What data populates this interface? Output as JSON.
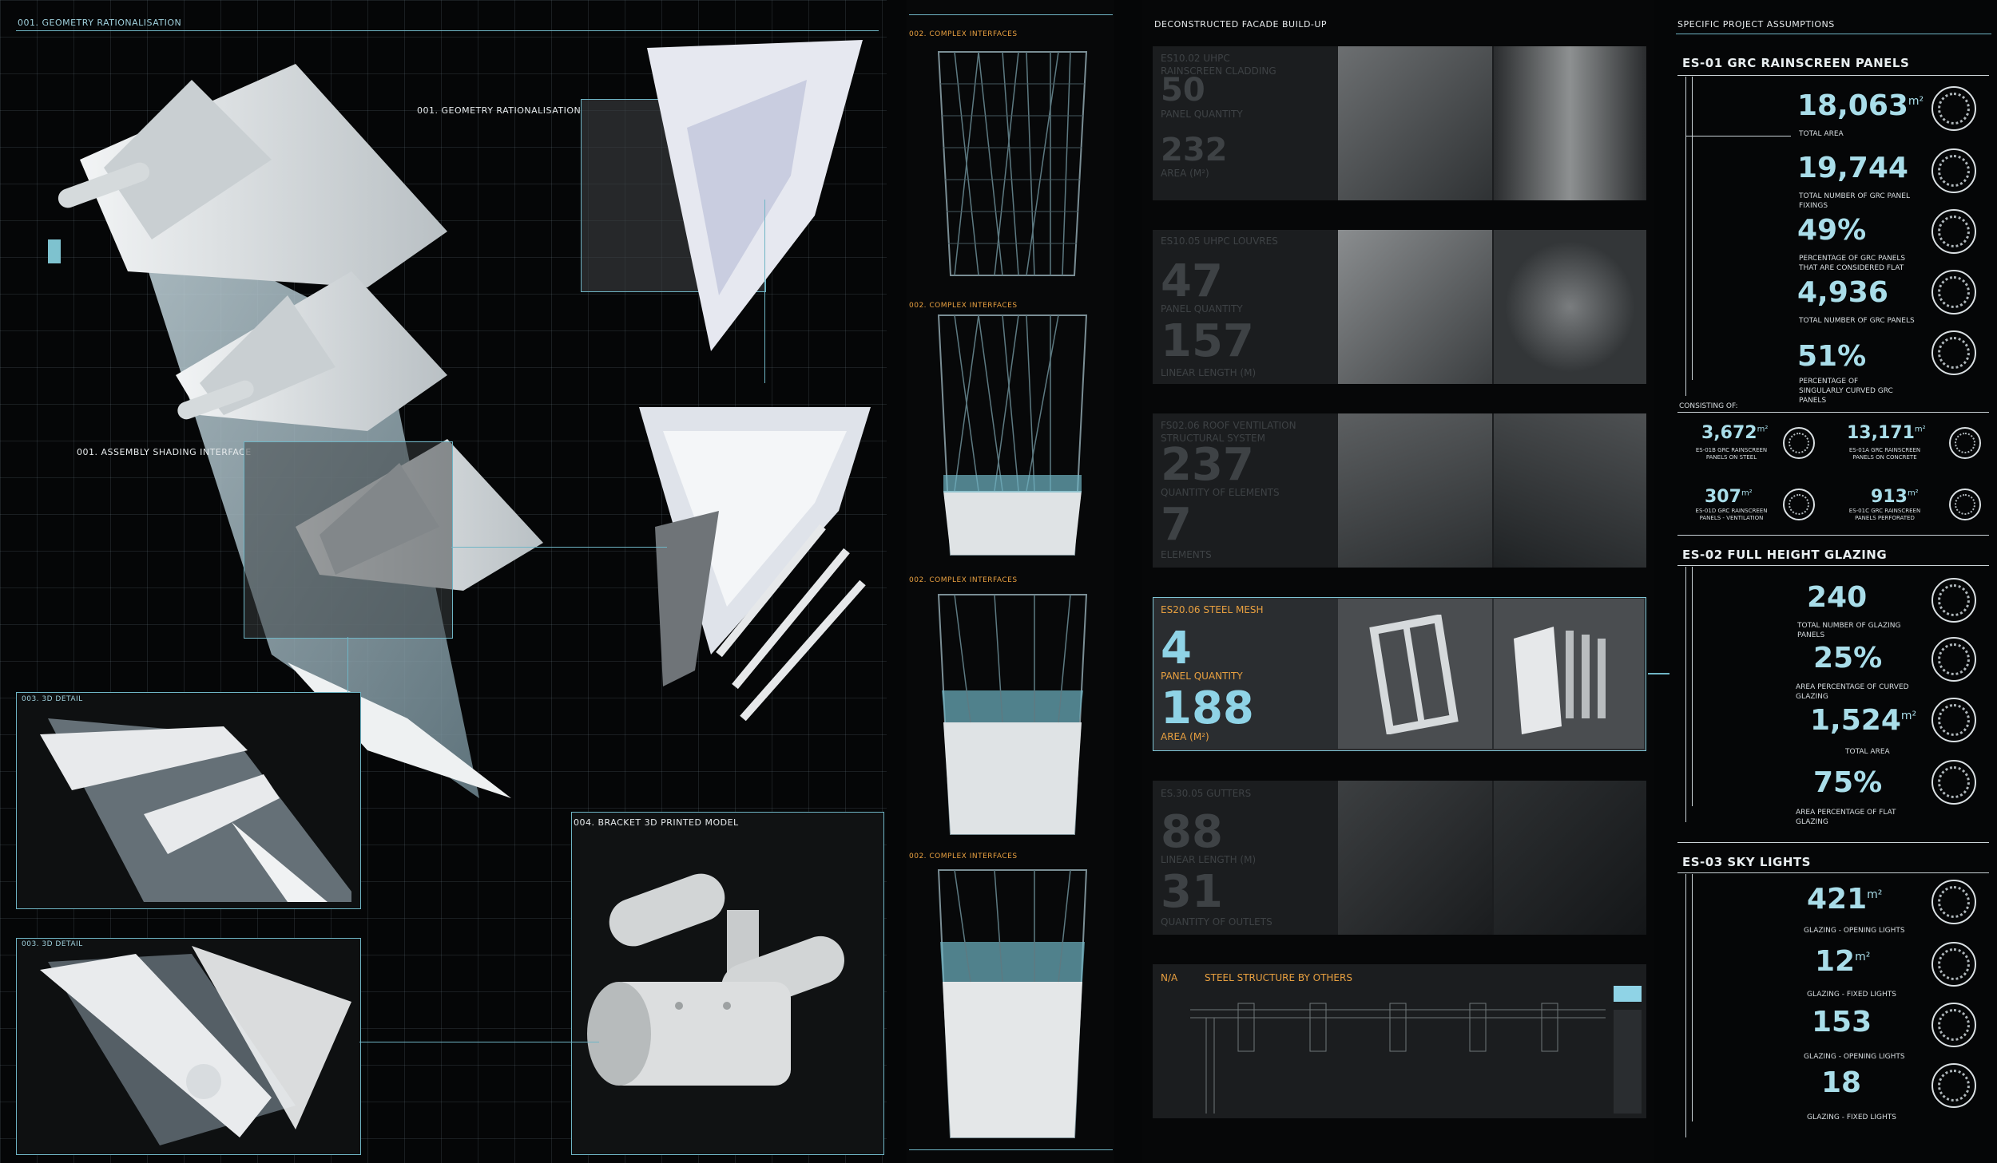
{
  "left": {
    "label_geometry_top": "001. GEOMETRY RATIONALISATION",
    "label_geometry_callout": "001. GEOMETRY RATIONALISATION",
    "label_assembly": "001. ASSEMBLY SHADING INTERFACE",
    "label_3d_detail_1": "003. 3D DETAIL",
    "label_3d_detail_2": "003. 3D DETAIL",
    "label_bracket": "004. BRACKET 3D PRINTED MODEL"
  },
  "middle": {
    "interfaces": [
      "002. COMPLEX INTERFACES",
      "002. COMPLEX INTERFACES",
      "002. COMPLEX INTERFACES",
      "002. COMPLEX INTERFACES"
    ]
  },
  "facade": {
    "title": "DECONSTRUCTED FACADE BUILD-UP",
    "rows": [
      {
        "code": "ES10.02 UHPC RAINSCREEN CLADDING",
        "n1": "50",
        "l1": "PANEL QUANTITY",
        "n2": "232",
        "l2": "AREA (m²)"
      },
      {
        "code": "ES10.05 UHPC LOUVRES",
        "n1": "47",
        "l1": "PANEL QUANTITY",
        "n2": "157",
        "l2": "LINEAR LENGTH (m)"
      },
      {
        "code": "FS02.06 ROOF VENTILATION STRUCTURAL SYSTEM",
        "n1": "237",
        "l1": "QUANTITY OF ELEMENTS",
        "n2": "7",
        "l2": "ELEMENTS"
      },
      {
        "code": "ES20.06   STEEL MESH",
        "n1": "4",
        "l1": "PANEL QUANTITY",
        "n2": "188",
        "l2": "AREA (m²)"
      },
      {
        "code": "ES.30.05 GUTTERS",
        "n1": "88",
        "l1": "LINEAR LENGTH (m)",
        "n2": "31",
        "l2": "QUANTITY OF OUTLETS"
      }
    ],
    "na_code": "N/A",
    "na_label": "STEEL STRUCTURE BY OTHERS"
  },
  "assumptions": {
    "title": "SPECIFIC PROJECT ASSUMPTIONS",
    "es01": {
      "title": "ES-01 GRC RAINSCREEN PANELS",
      "stats": [
        {
          "value": "18,063",
          "unit": "m²",
          "label": "TOTAL AREA"
        },
        {
          "value": "19,744",
          "unit": "",
          "label": "TOTAL NUMBER OF GRC PANEL FIXINGS"
        },
        {
          "value": "49%",
          "unit": "",
          "label": "PERCENTAGE OF GRC PANELS THAT ARE CONSIDERED FLAT"
        },
        {
          "value": "4,936",
          "unit": "",
          "label": "TOTAL NUMBER OF GRC PANELS"
        },
        {
          "value": "51%",
          "unit": "",
          "label": "PERCENTAGE OF SINGULARLY CURVED GRC PANELS"
        }
      ],
      "consisting": "CONSISTING OF:",
      "sub": [
        {
          "value": "3,672",
          "unit": "m²",
          "label": "ES-01B GRC RAINSCREEN PANELS ON STEEL"
        },
        {
          "value": "13,171",
          "unit": "m²",
          "label": "ES-01A GRC RAINSCREEN PANELS ON CONCRETE"
        },
        {
          "value": "307",
          "unit": "m²",
          "label": "ES-01D GRC RAINSCREEN PANELS - VENTILATION"
        },
        {
          "value": "913",
          "unit": "m²",
          "label": "ES-01C GRC RAINSCREEN PANELS PERFORATED"
        }
      ]
    },
    "es02": {
      "title": "ES-02 FULL HEIGHT GLAZING",
      "stats": [
        {
          "value": "240",
          "unit": "",
          "label": "TOTAL NUMBER OF GLAZING PANELS"
        },
        {
          "value": "25%",
          "unit": "",
          "label": "AREA PERCENTAGE OF CURVED GLAZING"
        },
        {
          "value": "1,524",
          "unit": "m²",
          "label": "TOTAL AREA"
        },
        {
          "value": "75%",
          "unit": "",
          "label": "AREA PERCENTAGE OF FLAT GLAZING"
        }
      ]
    },
    "es03": {
      "title": "ES-03 SKY LIGHTS",
      "stats": [
        {
          "value": "421",
          "unit": "m²",
          "label": "GLAZING - OPENING LIGHTS"
        },
        {
          "value": "12",
          "unit": "m²",
          "label": "GLAZING - FIXED LIGHTS"
        },
        {
          "value": "153",
          "unit": "",
          "label": "GLAZING - OPENING LIGHTS"
        },
        {
          "value": "18",
          "unit": "",
          "label": "GLAZING - FIXED LIGHTS"
        }
      ]
    }
  }
}
